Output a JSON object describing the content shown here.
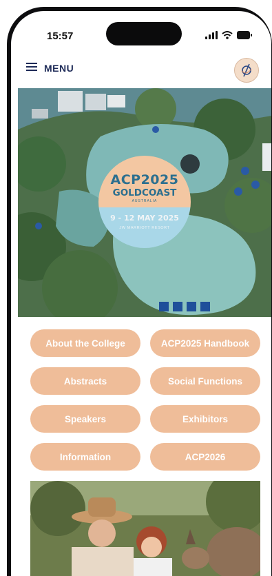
{
  "status": {
    "time": "15:57"
  },
  "nav": {
    "menu_label": "MENU"
  },
  "hero": {
    "badge_title": "ACP2025",
    "badge_subtitle": "GOLDCOAST",
    "badge_country": "AUSTRALIA",
    "badge_dates": "9 - 12 MAY 2025",
    "badge_venue": "JW MARRIOTT RESORT"
  },
  "buttons": [
    {
      "label": "About the College"
    },
    {
      "label": "ACP2025 Handbook"
    },
    {
      "label": "Abstracts"
    },
    {
      "label": "Social Functions"
    },
    {
      "label": "Speakers"
    },
    {
      "label": "Exhibitors"
    },
    {
      "label": "Information"
    },
    {
      "label": "ACP2026"
    }
  ],
  "colors": {
    "pill": "#efbd99",
    "nav_text": "#1d2a57",
    "badge_peach": "#f3c7a2",
    "badge_blue": "#a9d7e8"
  },
  "icons": [
    "hamburger-icon",
    "signal-icon",
    "wifi-icon",
    "battery-icon",
    "college-logo-icon"
  ]
}
